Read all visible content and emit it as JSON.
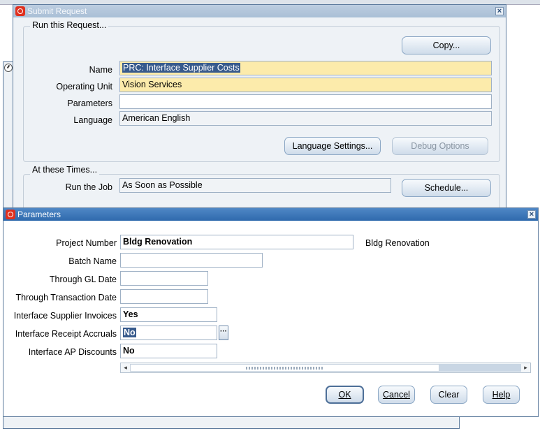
{
  "submit_request": {
    "title": "Submit Request",
    "close_glyph": "×",
    "run_group_label": "Run this Request...",
    "copy_button": "Copy...",
    "name_label": "Name",
    "name_value": "PRC: Interface Supplier Costs",
    "operating_unit_label": "Operating Unit",
    "operating_unit_value": "Vision Services",
    "parameters_label": "Parameters",
    "parameters_value": "",
    "language_label": "Language",
    "language_value": "American English",
    "language_settings_button": "Language Settings...",
    "debug_options_button": "Debug Options",
    "times_group_label": "At these Times...",
    "run_job_label": "Run the Job",
    "run_job_value": "As Soon as Possible",
    "schedule_button": "Schedule..."
  },
  "parameters": {
    "title": "Parameters",
    "close_glyph": "×",
    "fields": {
      "project_number": {
        "label": "Project Number",
        "value": "Bldg Renovation",
        "description": "Bldg Renovation"
      },
      "batch_name": {
        "label": "Batch Name",
        "value": ""
      },
      "through_gl_date": {
        "label": "Through GL Date",
        "value": ""
      },
      "through_transaction_date": {
        "label": "Through Transaction Date",
        "value": ""
      },
      "interface_supplier_invoices": {
        "label": "Interface Supplier Invoices",
        "value": "Yes"
      },
      "interface_receipt_accruals": {
        "label": "Interface Receipt Accruals",
        "value": "No"
      },
      "interface_ap_discounts": {
        "label": "Interface AP Discounts",
        "value": "No"
      }
    },
    "lov_glyph": "···",
    "scroll_left_glyph": "◂",
    "scroll_right_glyph": "▸",
    "buttons": {
      "ok": "OK",
      "cancel": "Cancel",
      "clear": "Clear",
      "help": "Help"
    }
  },
  "colors": {
    "required_field": "#fcebab",
    "active_titlebar": "#2f6aad",
    "inactive_titlebar": "#a9bfd6",
    "oracle_logo": "#e0301e"
  }
}
